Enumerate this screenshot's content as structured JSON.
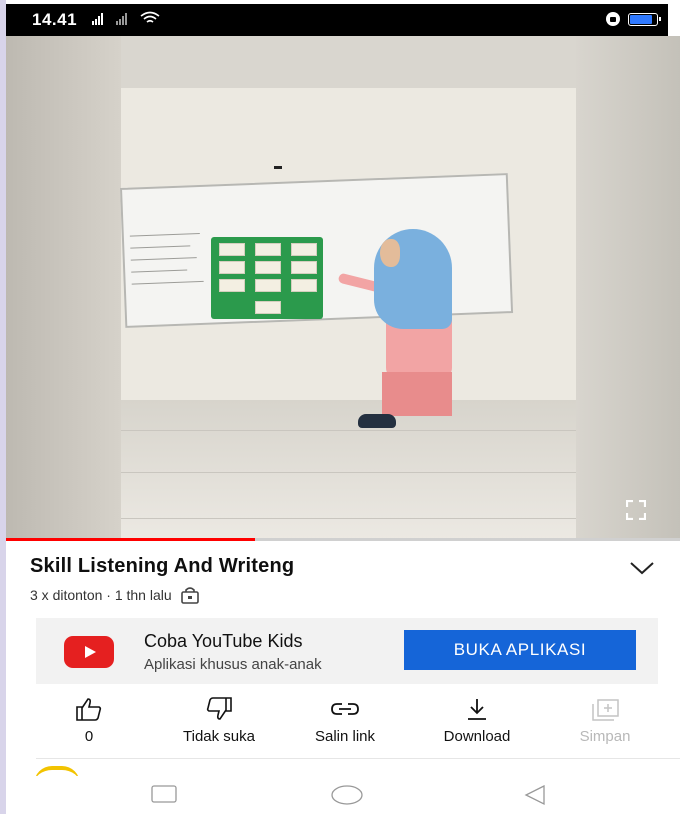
{
  "status_bar": {
    "time": "14.41",
    "battery_level": 0.85,
    "battery_color": "#2f79ff"
  },
  "video": {
    "progress": 0.37,
    "progress_color": "#ff0000"
  },
  "info": {
    "title": "Skill Listening And Writeng",
    "meta": "3 x ditonton · 1 thn lalu"
  },
  "banner": {
    "title": "Coba YouTube Kids",
    "subtitle": "Aplikasi khusus anak-anak",
    "button_label": "BUKA APLIKASI",
    "button_color": "#1565d8"
  },
  "actions": [
    {
      "icon": "thumbs-up-icon",
      "label": "0"
    },
    {
      "icon": "thumbs-down-icon",
      "label": "Tidak suka"
    },
    {
      "icon": "link-icon",
      "label": "Salin link"
    },
    {
      "icon": "download-icon",
      "label": "Download"
    },
    {
      "icon": "save-to-playlist-icon",
      "label": "Simpan",
      "disabled": true
    }
  ]
}
